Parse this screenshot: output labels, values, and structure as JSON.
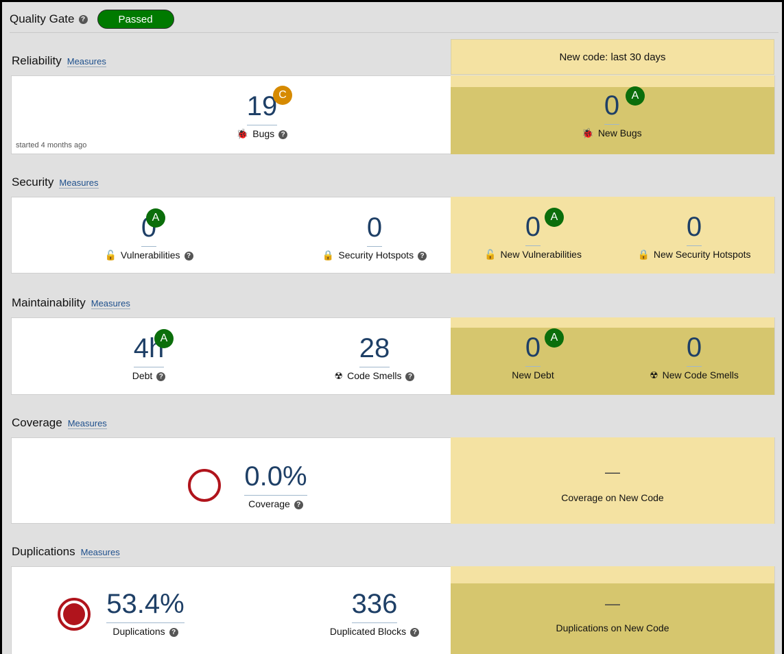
{
  "quality_gate": {
    "title": "Quality Gate",
    "status": "Passed"
  },
  "new_code_banner": "New code: last 30 days",
  "measures_label": "Measures",
  "reliability": {
    "title": "Reliability",
    "bugs": {
      "value": "19",
      "grade": "C",
      "label": "Bugs"
    },
    "started": "started 4 months ago",
    "new_bugs": {
      "value": "0",
      "grade": "A",
      "label": "New Bugs"
    }
  },
  "security": {
    "title": "Security",
    "vulnerabilities": {
      "value": "0",
      "grade": "A",
      "label": "Vulnerabilities"
    },
    "hotspots": {
      "value": "0",
      "label": "Security Hotspots"
    },
    "new_vulnerabilities": {
      "value": "0",
      "grade": "A",
      "label": "New Vulnerabilities"
    },
    "new_hotspots": {
      "value": "0",
      "label": "New Security Hotspots"
    }
  },
  "maintainability": {
    "title": "Maintainability",
    "debt": {
      "value": "4h",
      "grade": "A",
      "label": "Debt"
    },
    "code_smells": {
      "value": "28",
      "label": "Code Smells"
    },
    "new_debt": {
      "value": "0",
      "grade": "A",
      "label": "New Debt"
    },
    "new_code_smells": {
      "value": "0",
      "label": "New Code Smells"
    }
  },
  "coverage": {
    "title": "Coverage",
    "coverage": {
      "value": "0.0%",
      "label": "Coverage"
    },
    "new_coverage": {
      "value": "—",
      "label": "Coverage on New Code"
    }
  },
  "duplications": {
    "title": "Duplications",
    "duplications": {
      "value": "53.4%",
      "label": "Duplications"
    },
    "blocks": {
      "value": "336",
      "label": "Duplicated Blocks"
    },
    "new_duplications": {
      "value": "—",
      "label": "Duplications on New Code"
    }
  },
  "colors": {
    "grade_a": "#0b6e0b",
    "grade_c": "#d68a00",
    "passed": "#007a00",
    "link": "#1d4f8c",
    "value": "#1e3f66"
  }
}
